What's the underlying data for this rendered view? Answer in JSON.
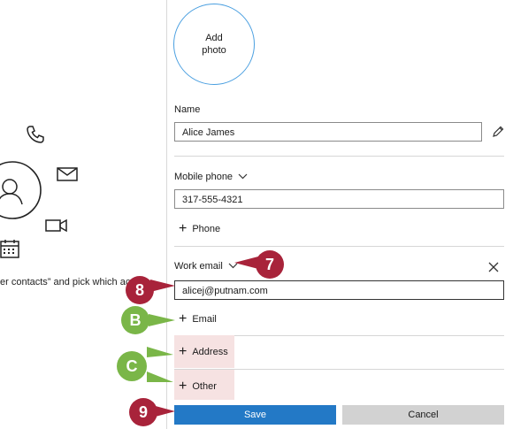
{
  "left_panel": {
    "hint_text": "er contacts” and pick which acco"
  },
  "photo": {
    "line1": "Add",
    "line2": "photo"
  },
  "name_section": {
    "label": "Name",
    "value": "Alice James"
  },
  "mobile_section": {
    "label": "Mobile phone",
    "value": "317-555-4321",
    "add_label": "Phone"
  },
  "email_section": {
    "label": "Work email",
    "value": "alicej@putnam.com",
    "add_label": "Email"
  },
  "address": {
    "add_label": "Address"
  },
  "other": {
    "add_label": "Other"
  },
  "actions": {
    "save_label": "Save",
    "cancel_label": "Cancel"
  },
  "callouts": {
    "seven": "7",
    "eight": "8",
    "nine": "9",
    "b": "B",
    "c": "C"
  },
  "colors": {
    "accent": "#2379c6",
    "callout_red": "#a8233a",
    "callout_green": "#7ab648",
    "highlight": "#f6e2e2"
  }
}
